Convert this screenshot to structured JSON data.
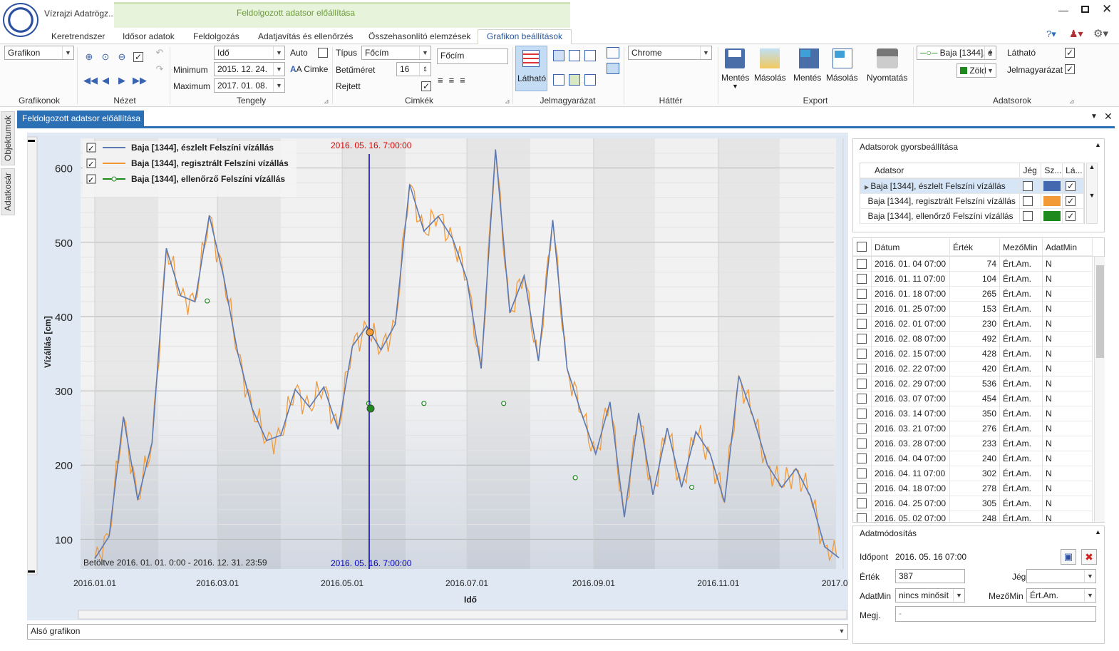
{
  "app": {
    "title": "Vízrajzi Adatrögz...",
    "context_tab_group": "Feldolgozott adatsor előállítása"
  },
  "tabs": [
    "Keretrendszer",
    "Idősor adatok",
    "Feldolgozás",
    "Adatjavítás és ellenőrzés",
    "Összehasonlító elemzések",
    "Grafikon beállítások"
  ],
  "ribbon": {
    "grafikonok": {
      "label": "Grafikonok",
      "combo": "Grafikon"
    },
    "nezet": {
      "label": "Nézet"
    },
    "tengely": {
      "label": "Tengely",
      "type_value": "Idő",
      "min_label": "Minimum",
      "min_value": "2015. 12. 24.",
      "max_label": "Maximum",
      "max_value": "2017. 01. 08.",
      "auto_label": "Auto",
      "cimke_label": "Cimke"
    },
    "cimkek": {
      "label": "Cimkék",
      "tipus_label": "Típus",
      "tipus_value": "Főcím",
      "betumeret_label": "Betűméret",
      "betumeret_value": "16",
      "rejtett_label": "Rejtett",
      "title_input": "Főcím"
    },
    "jelmagyarazat": {
      "label": "Jelmagyarázat",
      "lathato": "Látható"
    },
    "hatter": {
      "label": "Háttér",
      "value": "Chrome"
    },
    "export": {
      "label": "Export",
      "btn1": "Mentés",
      "btn2": "Másolás",
      "btn3": "Mentés",
      "btn4": "Másolás",
      "btn5": "Nyomtatás"
    },
    "adatsorok": {
      "label": "Adatsorok",
      "series_value": "Baja [1344], é",
      "color_value": "Zöld",
      "lathato_label": "Látható",
      "jelm_label": "Jelmagyarázat"
    }
  },
  "doc_tab": "Feldolgozott adatsor előállítása",
  "side_tabs": [
    "Objektumok",
    "Adatkosár"
  ],
  "chart_data": {
    "type": "line",
    "xlabel": "Idő",
    "ylabel": "Vízállás [cm]",
    "ylim": [
      60,
      640
    ],
    "yticks": [
      100,
      200,
      300,
      400,
      500,
      600
    ],
    "xticks": [
      "2016.01.01",
      "2016.03.01",
      "2016.05.01",
      "2016.07.01",
      "2016.09.01",
      "2016.11.01",
      "2017.01.01"
    ],
    "cursor_label_top": "2016. 05. 16. 7:00:00",
    "cursor_label_bottom": "2016. 05. 16. 7:00:00",
    "loaded_text": "Betöltve 2016. 01. 01. 0:00 - 2016. 12. 31. 23:59",
    "legend": [
      "Baja [1344], észlelt Felszíni vízállás",
      "Baja [1344], regisztrált Felszíni vízállás",
      "Baja [1344], ellenőrző Felszíni vízállás"
    ],
    "series": [
      {
        "name": "Baja [1344], észlelt Felszíni vízállás",
        "color": "#5b7ab5",
        "x": [
          0,
          7,
          14,
          21,
          28,
          35,
          42,
          49,
          56,
          63,
          70,
          77,
          84,
          91,
          98,
          105,
          112,
          119,
          126,
          133,
          140,
          147,
          154,
          161,
          168,
          175,
          182,
          189,
          196,
          203,
          210,
          217,
          224,
          231,
          238,
          245,
          252,
          259,
          266,
          273,
          280,
          287,
          294,
          301,
          308,
          315,
          322,
          329,
          336,
          343,
          350,
          357,
          364
        ],
        "y": [
          74,
          104,
          265,
          153,
          230,
          492,
          428,
          420,
          536,
          454,
          350,
          276,
          233,
          240,
          302,
          278,
          305,
          248,
          360,
          387,
          355,
          390,
          578,
          515,
          535,
          505,
          450,
          330,
          625,
          405,
          455,
          340,
          530,
          330,
          270,
          215,
          285,
          130,
          270,
          160,
          250,
          170,
          245,
          215,
          150,
          320,
          265,
          200,
          170,
          195,
          158,
          90,
          75
        ]
      },
      {
        "name": "Baja [1344], regisztrált Felszíni vízállás",
        "color": "#f29a38"
      },
      {
        "name": "Baja [1344], ellenőrző Felszíni vízállás",
        "color": "#1e8a1e",
        "x": [
          55,
          134,
          161,
          200,
          235,
          292
        ],
        "y": [
          421,
          283,
          283,
          283,
          183,
          170
        ]
      }
    ]
  },
  "bottom_combo": "Alsó grafikon",
  "quick": {
    "title": "Adatsorok gyorsbeállítása",
    "col_adatsor": "Adatsor",
    "col_jeg": "Jég",
    "col_sz": "Sz...",
    "col_la": "Lá...",
    "rows": [
      {
        "name": "Baja [1344], észlelt Felszíni vízállás",
        "color": "#4468b0"
      },
      {
        "name": "Baja [1344], regisztrált Felszíni vízállás",
        "color": "#f29a38"
      },
      {
        "name": "Baja [1344], ellenőrző Felszíni vízállás",
        "color": "#1e8a1e"
      }
    ]
  },
  "table": {
    "cols": [
      "Dátum",
      "Érték",
      "MezőMin",
      "AdatMin"
    ],
    "rows": [
      [
        "2016. 01. 04 07:00",
        "74",
        "Ért.Am.",
        "N"
      ],
      [
        "2016. 01. 11 07:00",
        "104",
        "Ért.Am.",
        "N"
      ],
      [
        "2016. 01. 18 07:00",
        "265",
        "Ért.Am.",
        "N"
      ],
      [
        "2016. 01. 25 07:00",
        "153",
        "Ért.Am.",
        "N"
      ],
      [
        "2016. 02. 01 07:00",
        "230",
        "Ért.Am.",
        "N"
      ],
      [
        "2016. 02. 08 07:00",
        "492",
        "Ért.Am.",
        "N"
      ],
      [
        "2016. 02. 15 07:00",
        "428",
        "Ért.Am.",
        "N"
      ],
      [
        "2016. 02. 22 07:00",
        "420",
        "Ért.Am.",
        "N"
      ],
      [
        "2016. 02. 29 07:00",
        "536",
        "Ért.Am.",
        "N"
      ],
      [
        "2016. 03. 07 07:00",
        "454",
        "Ért.Am.",
        "N"
      ],
      [
        "2016. 03. 14 07:00",
        "350",
        "Ért.Am.",
        "N"
      ],
      [
        "2016. 03. 21 07:00",
        "276",
        "Ért.Am.",
        "N"
      ],
      [
        "2016. 03. 28 07:00",
        "233",
        "Ért.Am.",
        "N"
      ],
      [
        "2016. 04. 04 07:00",
        "240",
        "Ért.Am.",
        "N"
      ],
      [
        "2016. 04. 11 07:00",
        "302",
        "Ért.Am.",
        "N"
      ],
      [
        "2016. 04. 18 07:00",
        "278",
        "Ért.Am.",
        "N"
      ],
      [
        "2016. 04. 25 07:00",
        "305",
        "Ért.Am.",
        "N"
      ],
      [
        "2016. 05. 02 07:00",
        "248",
        "Ért.Am.",
        "N"
      ]
    ]
  },
  "mod": {
    "title": "Adatmódosítás",
    "idopont_label": "Időpont",
    "idopont": "2016. 05. 16 07:00",
    "ertek_label": "Érték",
    "ertek": "387",
    "jeg_label": "Jég",
    "adatmin_label": "AdatMin",
    "adatmin": "nincs minősít",
    "mezomin_label": "MezőMin",
    "mezomin": "Ért.Am.",
    "megj_label": "Megj.",
    "megj": "-"
  }
}
